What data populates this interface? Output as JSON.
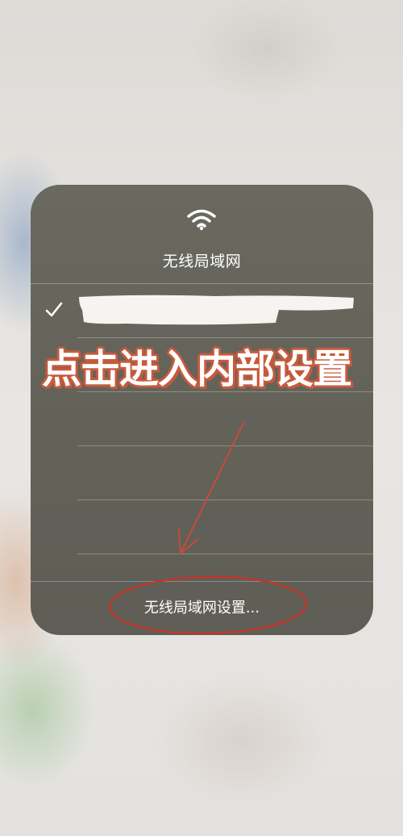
{
  "panel": {
    "title": "无线局域网",
    "wifi_icon": "wifi-icon",
    "connected_network": {
      "checkmark_icon": "checkmark-icon",
      "name_redacted": true
    },
    "empty_rows": 4,
    "settings_link": "无线局域网设置..."
  },
  "annotation": {
    "caption": "点击进入内部设置",
    "arrow_color": "#c94a3a",
    "circle_color": "#c0362c",
    "caption_outline_color": "#c75a3c"
  },
  "colors": {
    "panel": "#65645b",
    "text": "#ffffff"
  }
}
